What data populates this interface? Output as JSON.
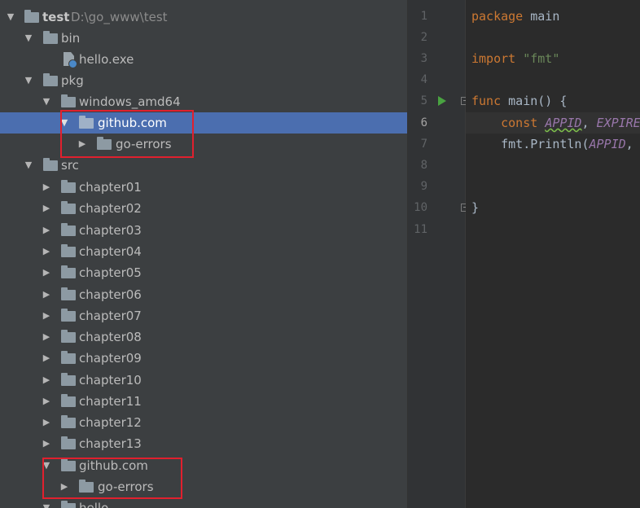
{
  "project": {
    "root_name": "test",
    "root_path": "D:\\go_www\\test",
    "folders": {
      "bin": "bin",
      "hello_exe": "hello.exe",
      "pkg": "pkg",
      "windows_amd64": "windows_amd64",
      "github_pkg": "github.com",
      "go_errors_pkg": "go-errors",
      "src": "src",
      "github_src": "github.com",
      "go_errors_src": "go-errors",
      "hello": "hello"
    },
    "chapters": [
      "chapter01",
      "chapter02",
      "chapter03",
      "chapter04",
      "chapter05",
      "chapter06",
      "chapter07",
      "chapter08",
      "chapter09",
      "chapter10",
      "chapter11",
      "chapter12",
      "chapter13"
    ],
    "selected_item": "github.com"
  },
  "editor": {
    "line_numbers": [
      "1",
      "2",
      "3",
      "4",
      "5",
      "6",
      "7",
      "8",
      "9",
      "10",
      "11"
    ],
    "current_line": "6",
    "code": {
      "l1_kw": "package",
      "l1_name": " main",
      "l3_kw": "import",
      "l3_str": "\"fmt\"",
      "l5_kw": "func",
      "l5_rest": " main() {",
      "l6_kw": "const",
      "l6_c1": "APPID",
      "l6_sep": ", ",
      "l6_c2": "EXPIRE",
      "l7_pre": "fmt.Println(",
      "l7_c1": "APPID",
      "l7_rest": ",",
      "l10": "}"
    }
  },
  "colors": {
    "selection": "#4b6eaf",
    "highlight_box": "#e0202e",
    "keyword": "#cc7832",
    "string": "#6a8759",
    "constant": "#9876aa",
    "run_icon": "#49a341"
  },
  "icons": {
    "expanded": "triangle-down",
    "collapsed": "triangle-right",
    "folder": "folder-icon",
    "file": "exe-file-icon",
    "run": "run-gutter-icon"
  }
}
